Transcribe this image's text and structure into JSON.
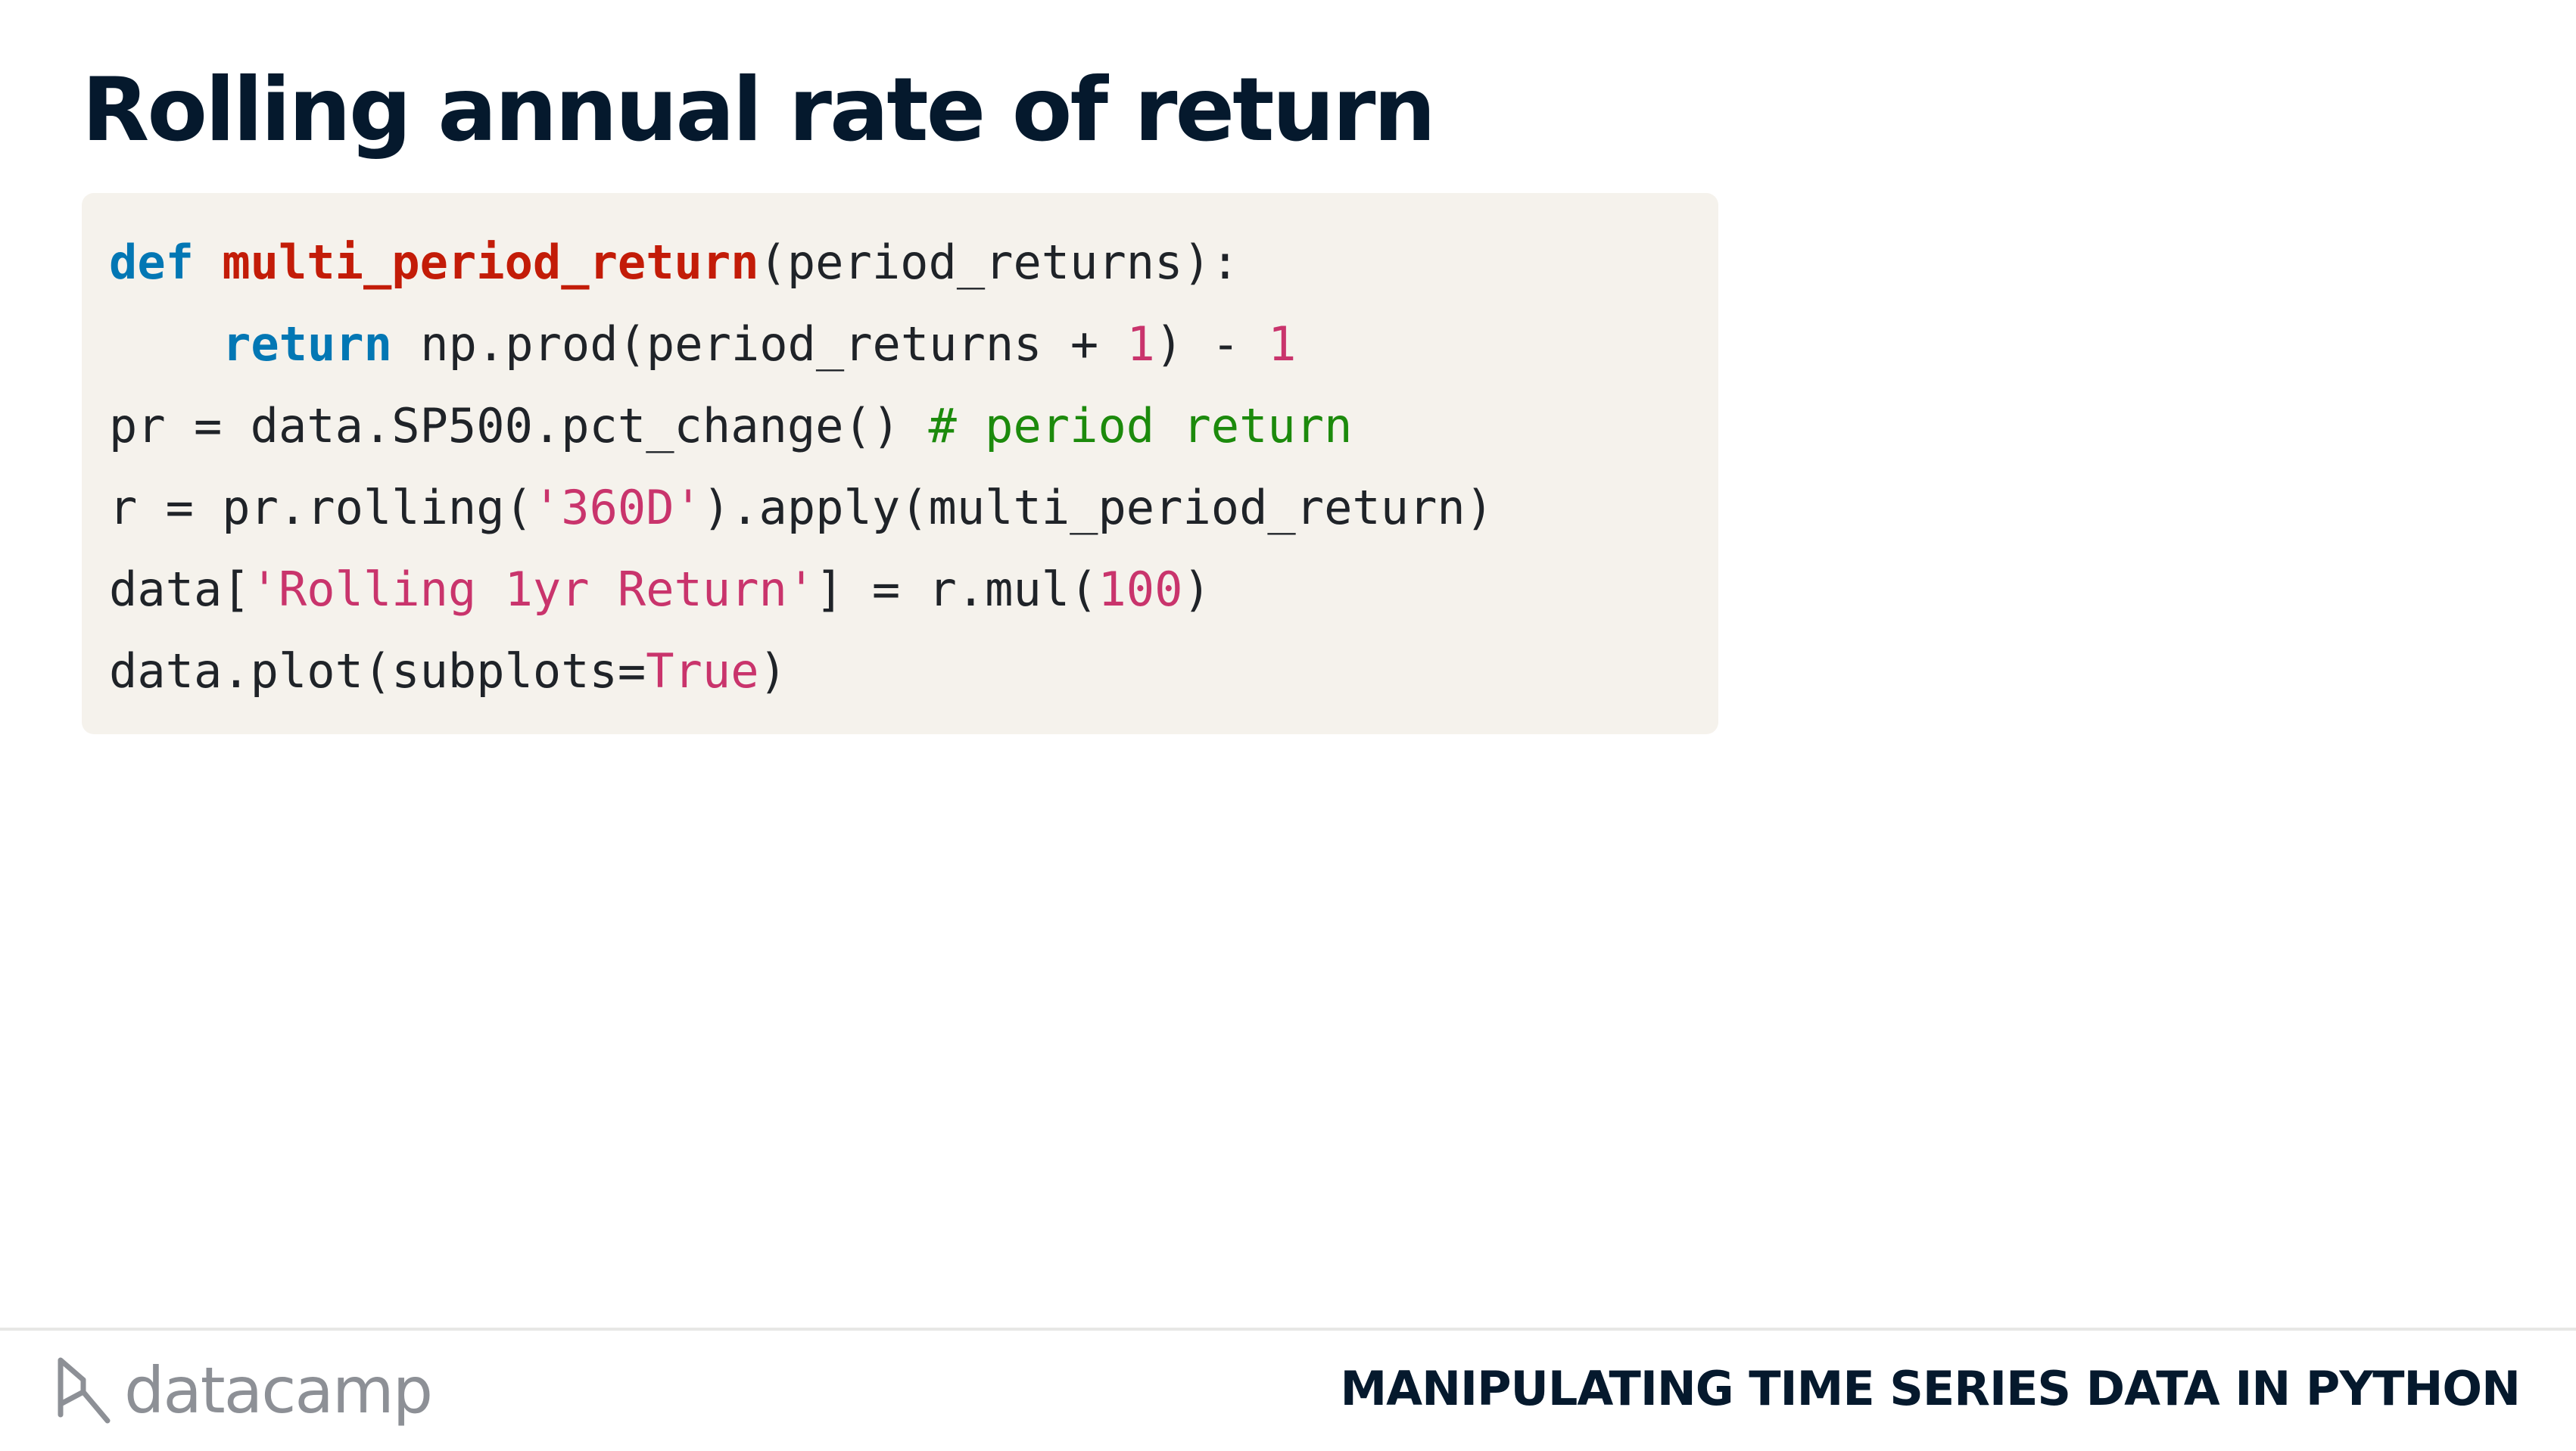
{
  "slide": {
    "title": "Rolling annual rate of return"
  },
  "code": {
    "line1": {
      "kw": "def",
      "fn": "multi_period_return",
      "rest": "(period_returns):"
    },
    "line2": {
      "kw": "return",
      "a": " np.prod(period_returns + ",
      "n1": "1",
      "b": ") - ",
      "n2": "1"
    },
    "line3": {
      "a": "pr = data.SP500.pct_change() ",
      "comment": "# period return"
    },
    "line4": {
      "a": "r = pr.rolling(",
      "str": "'360D'",
      "b": ").apply(multi_period_return)"
    },
    "line5": {
      "a": "data[",
      "str": "'Rolling 1yr Return'",
      "b": "] = r.mul(",
      "num": "100",
      "c": ")"
    },
    "line6": {
      "a": "data.plot(subplots=",
      "kw": "True",
      "b": ")"
    }
  },
  "footer": {
    "logo_text": "datacamp",
    "logo_icon": "datacamp-logo-icon",
    "course_title": "MANIPULATING TIME SERIES DATA IN PYTHON"
  }
}
